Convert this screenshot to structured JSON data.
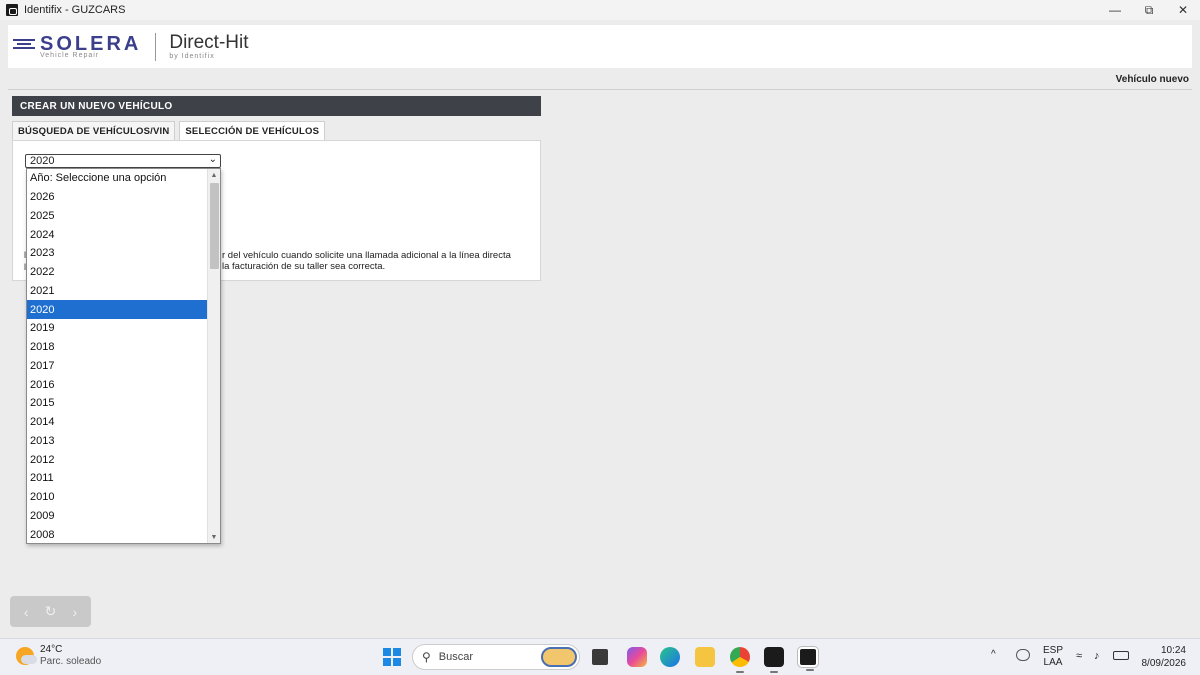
{
  "window": {
    "title": "Identifix - GUZCARS",
    "minimize_glyph": "—",
    "restore_glyph": "⧉",
    "close_glyph": "✕"
  },
  "header": {
    "brand": "SOLERA",
    "brand_sub": "Vehicle Repair",
    "product": "Direct-Hit",
    "product_sub": "by Identifix",
    "brand_color": "#3b3f8c"
  },
  "page": {
    "top_right_label": "Vehículo nuevo",
    "panel_title": "CREAR UN NUEVO VEHÍCULO",
    "tabs": [
      {
        "label": "BÚSQUEDA DE VEHÍCULOS/VIN",
        "active": false
      },
      {
        "label": "SELECCIÓN DE VEHÍCULOS",
        "active": true
      }
    ],
    "note_line1": "r del vehículo cuando solicite una llamada adicional a la línea directa",
    "note_line2": "la facturación de su taller sea correcta."
  },
  "year_select": {
    "selected_value": "2020",
    "chevron": "⌄",
    "options": [
      "Año: Seleccione una opción",
      "2026",
      "2025",
      "2024",
      "2023",
      "2022",
      "2021",
      "2020",
      "2019",
      "2018",
      "2017",
      "2016",
      "2015",
      "2014",
      "2013",
      "2012",
      "2011",
      "2010",
      "2009",
      "2008"
    ],
    "selected_index": 7,
    "highlight_color": "#1f6fd1"
  },
  "nav_widget": {
    "back_glyph": "‹",
    "refresh_glyph": "↻",
    "forward_glyph": "›"
  },
  "taskbar": {
    "weather_temp": "24°C",
    "weather_desc": "Parc. soleado",
    "search_placeholder": "Buscar",
    "lang_line1": "ESP",
    "lang_line2": "LAA",
    "time": "10:24",
    "date": "8/09/2026"
  }
}
